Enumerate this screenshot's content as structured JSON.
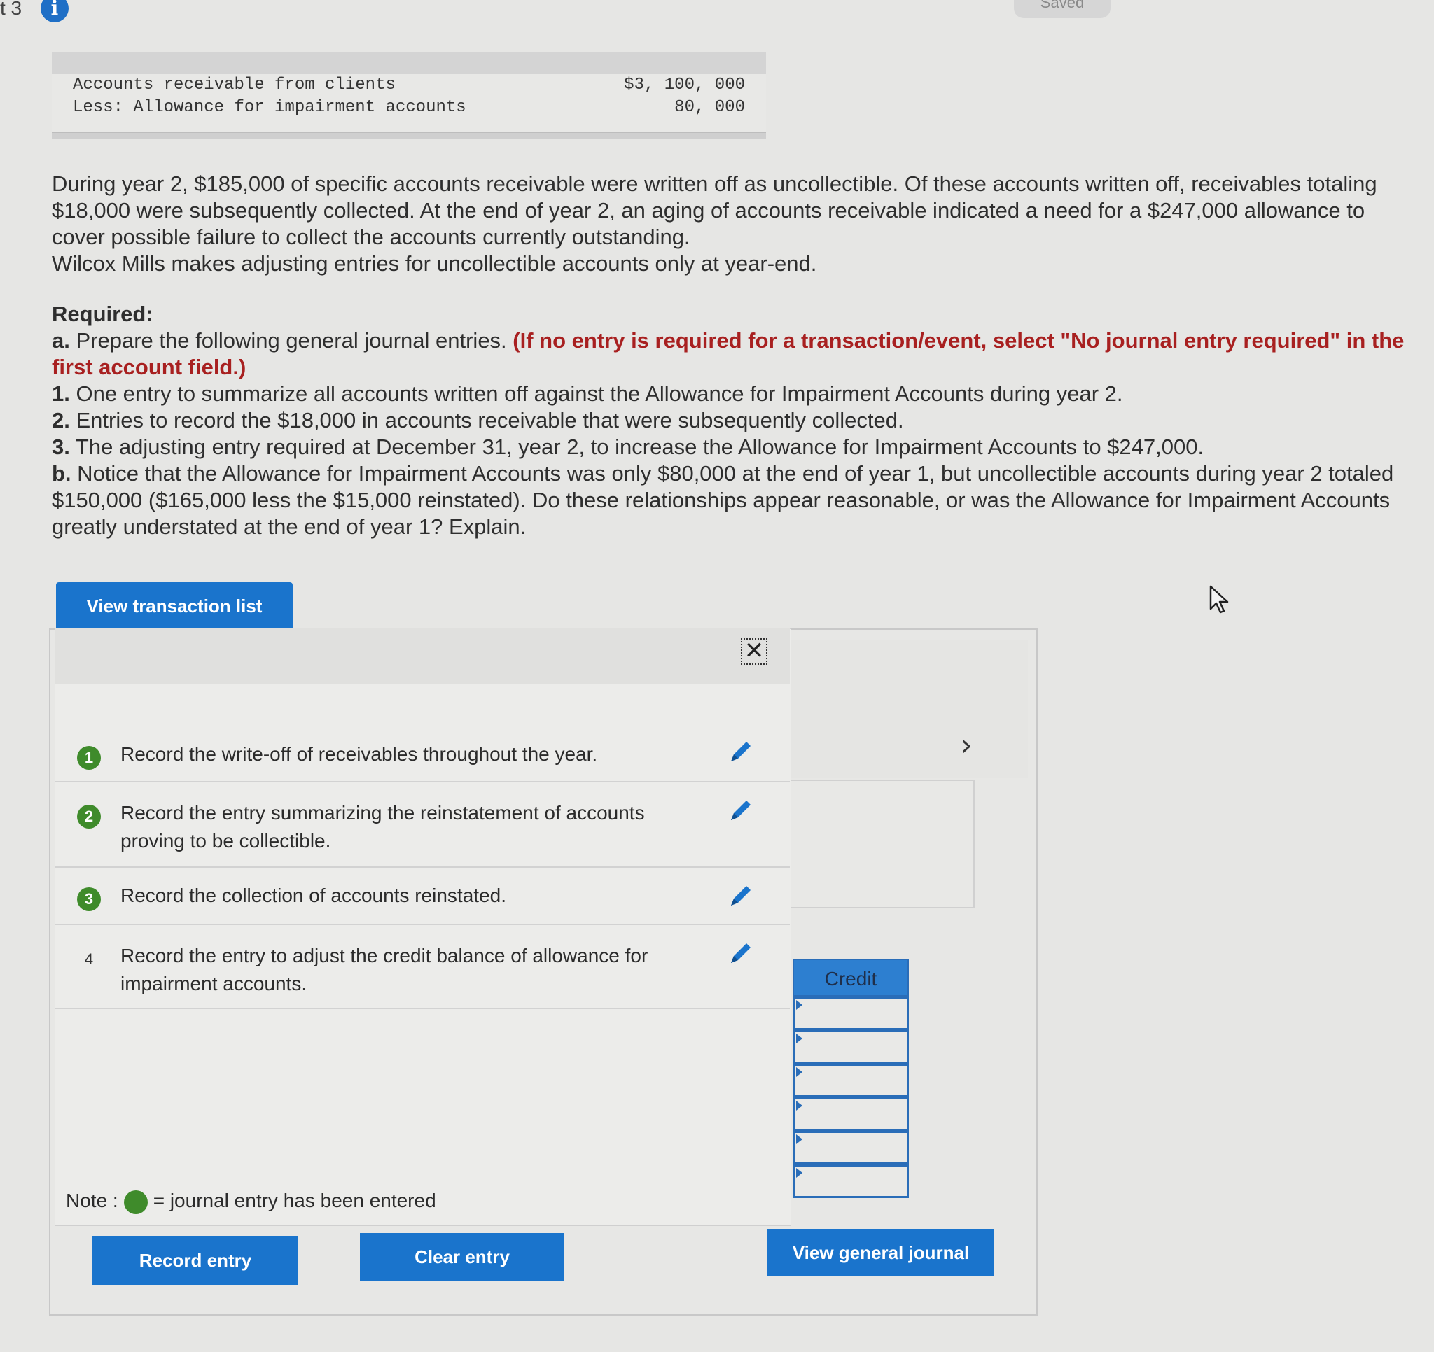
{
  "header": {
    "part_label": "t 3",
    "info_icon": "i",
    "saved_label": "Saved"
  },
  "statement": {
    "rows": [
      {
        "label": "Accounts receivable from clients",
        "amount": "$3, 100, 000"
      },
      {
        "label": "Less: Allowance for impairment accounts",
        "amount": "80, 000"
      }
    ]
  },
  "problem": {
    "para1": "During year 2, $185,000 of specific accounts receivable were written off as uncollectible. Of these accounts written off, receivables totaling $18,000 were subsequently collected. At the end of year 2, an aging of accounts receivable indicated a need for a $247,000 allowance to cover possible failure to collect the accounts currently outstanding.",
    "para2": "Wilcox Mills makes adjusting entries for uncollectible accounts only at year-end.",
    "required_label": "Required:",
    "a_prefix": "a.",
    "a_text": " Prepare the following general journal entries. ",
    "a_red": "(If no entry is required for a transaction/event, select \"No journal entry required\" in the first account field.)",
    "item1_num": "1.",
    "item1": " One entry to summarize all accounts written off against the Allowance for Impairment Accounts during year 2.",
    "item2_num": "2.",
    "item2": " Entries to record the $18,000 in accounts receivable that were subsequently collected.",
    "item3_num": "3.",
    "item3": " The adjusting entry required at December 31, year 2, to increase the Allowance for Impairment Accounts to $247,000.",
    "b_prefix": "b.",
    "b_text": " Notice that the Allowance for Impairment Accounts was only $80,000 at the end of year 1, but uncollectible accounts during year 2 totaled $150,000 ($165,000 less the $15,000 reinstated). Do these relationships appear reasonable, or was the Allowance for Impairment Accounts greatly understated at the end of year 1? Explain."
  },
  "panel": {
    "view_transaction_list": "View transaction list",
    "close_icon": "close-icon",
    "transactions": [
      {
        "num": "1",
        "completed": true,
        "text": "Record the write-off of receivables throughout the year."
      },
      {
        "num": "2",
        "completed": true,
        "text": "Record the entry summarizing the reinstatement of accounts proving to be collectible."
      },
      {
        "num": "3",
        "completed": true,
        "text": "Record the collection of accounts reinstated."
      },
      {
        "num": "4",
        "completed": false,
        "text": "Record the entry to adjust the credit balance of allowance for impairment accounts."
      }
    ],
    "credit_header": "Credit",
    "chevron": "›",
    "note_prefix": "Note :",
    "note_text": "= journal entry has been entered",
    "record_entry": "Record entry",
    "clear_entry": "Clear entry",
    "view_general_journal": "View general journal"
  },
  "colors": {
    "accent": "#1a74cc",
    "completed": "#3f8b2b",
    "warning_text": "#a82020"
  }
}
